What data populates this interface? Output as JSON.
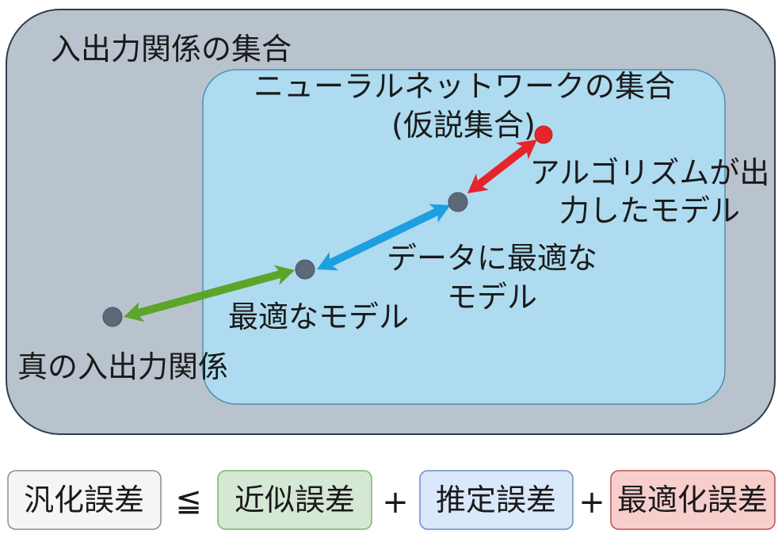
{
  "outer_set": {
    "label": "入出力関係の集合"
  },
  "hypothesis_set": {
    "label": "ニューラルネットワークの集合",
    "sublabel": "(仮説集合)"
  },
  "models": {
    "algorithm_output": {
      "label_line1": "アルゴリズムが出",
      "label_line2": "力したモデル"
    },
    "data_optimal": {
      "label_line1": "データに最適な",
      "label_line2": "モデル"
    },
    "optimal": {
      "label": "最適なモデル"
    },
    "true_relation": {
      "label": "真の入出力関係"
    }
  },
  "equation": {
    "generalization_error": "汎化誤差",
    "relation": "≦",
    "approximation_error": "近似誤差",
    "plus_1": "+",
    "estimation_error": "推定誤差",
    "plus_2": "+",
    "optimization_error": "最適化誤差"
  },
  "colors": {
    "outer_set": "#b9c3cd",
    "hypothesis_set": "#aedbef",
    "approximation": "#5ba52a",
    "estimation": "#1d9fe0",
    "optimization": "#e6242b",
    "model_point": "#5d6979",
    "algorithm_point": "#e6242b",
    "generalization_box": "#f5f5f5",
    "approximation_box": "#d5e8d4",
    "estimation_box": "#dae8fc",
    "optimization_box": "#f8cecc"
  }
}
